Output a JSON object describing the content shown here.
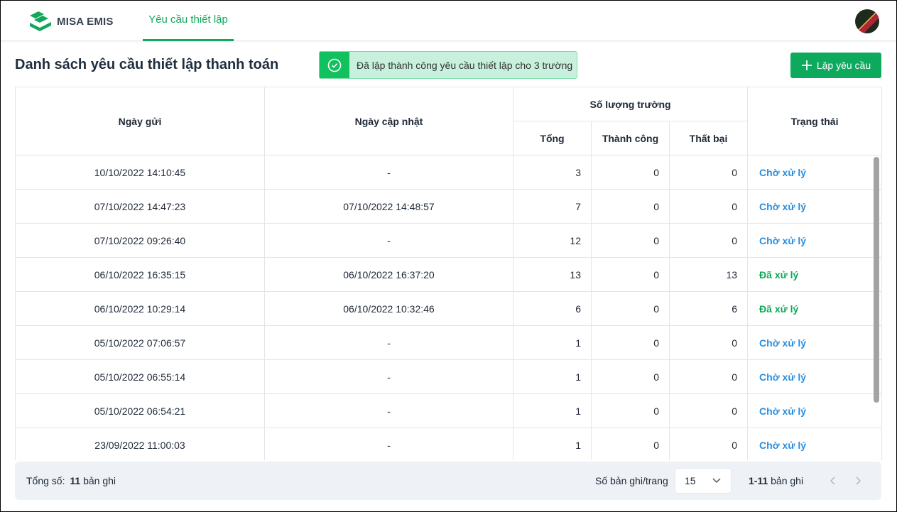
{
  "header": {
    "brand": "MISA EMIS",
    "tab": "Yêu cầu thiết lập"
  },
  "page": {
    "title": "Danh sách yêu cầu thiết lập thanh toán",
    "toast": "Đã lập thành công yêu cầu thiết lập cho 3 trường",
    "create_button": "Lập yêu cầu"
  },
  "colors": {
    "accent": "#0daa5e",
    "pending": "#2a8ee0",
    "done": "#10a85a"
  },
  "table": {
    "headers": {
      "sent": "Ngày gửi",
      "updated": "Ngày cập nhật",
      "count_group": "Số lượng trường",
      "total": "Tổng",
      "success": "Thành công",
      "failed": "Thất bại",
      "status": "Trạng thái"
    },
    "rows": [
      {
        "sent": "10/10/2022 14:10:45",
        "updated": "-",
        "total": "3",
        "success": "0",
        "failed": "0",
        "status": "Chờ xử lý",
        "kind": "pending"
      },
      {
        "sent": "07/10/2022 14:47:23",
        "updated": "07/10/2022 14:48:57",
        "total": "7",
        "success": "0",
        "failed": "0",
        "status": "Chờ xử lý",
        "kind": "pending"
      },
      {
        "sent": "07/10/2022 09:26:40",
        "updated": "-",
        "total": "12",
        "success": "0",
        "failed": "0",
        "status": "Chờ xử lý",
        "kind": "pending"
      },
      {
        "sent": "06/10/2022 16:35:15",
        "updated": "06/10/2022 16:37:20",
        "total": "13",
        "success": "0",
        "failed": "13",
        "status": "Đã xử lý",
        "kind": "done"
      },
      {
        "sent": "06/10/2022 10:29:14",
        "updated": "06/10/2022 10:32:46",
        "total": "6",
        "success": "0",
        "failed": "6",
        "status": "Đã xử lý",
        "kind": "done"
      },
      {
        "sent": "05/10/2022 07:06:57",
        "updated": "-",
        "total": "1",
        "success": "0",
        "failed": "0",
        "status": "Chờ xử lý",
        "kind": "pending"
      },
      {
        "sent": "05/10/2022 06:55:14",
        "updated": "-",
        "total": "1",
        "success": "0",
        "failed": "0",
        "status": "Chờ xử lý",
        "kind": "pending"
      },
      {
        "sent": "05/10/2022 06:54:21",
        "updated": "-",
        "total": "1",
        "success": "0",
        "failed": "0",
        "status": "Chờ xử lý",
        "kind": "pending"
      },
      {
        "sent": "23/09/2022 11:00:03",
        "updated": "-",
        "total": "1",
        "success": "0",
        "failed": "0",
        "status": "Chờ xử lý",
        "kind": "pending"
      }
    ]
  },
  "footer": {
    "total_label": "Tổng số:",
    "total_value": "11",
    "total_unit": "bản ghi",
    "page_size_label": "Số bản ghi/trang",
    "page_size": "15",
    "range": "1-11",
    "range_unit": "bản ghi"
  }
}
